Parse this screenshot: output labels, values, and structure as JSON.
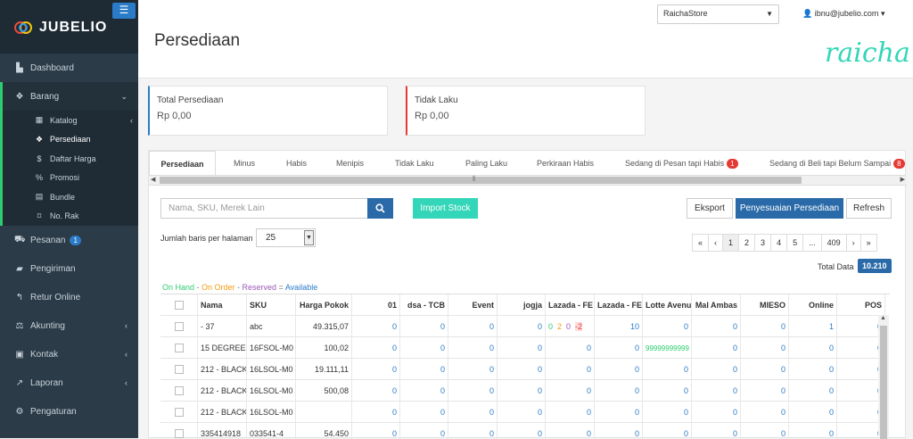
{
  "app": {
    "brand": "JUBELIO",
    "page_title": "Persediaan"
  },
  "sidebar": {
    "items": [
      {
        "label": "Dashboard",
        "icon": "chart-area-icon"
      },
      {
        "label": "Barang",
        "icon": "cubes-icon"
      },
      {
        "label": "Pesanan",
        "icon": "basket-icon",
        "badge": "1"
      },
      {
        "label": "Pengiriman",
        "icon": "truck-icon"
      },
      {
        "label": "Retur Online",
        "icon": "reply-icon"
      },
      {
        "label": "Akunting",
        "icon": "balance-icon"
      },
      {
        "label": "Kontak",
        "icon": "address-card-icon"
      },
      {
        "label": "Laporan",
        "icon": "line-chart-icon"
      },
      {
        "label": "Pengaturan",
        "icon": "cogs-icon"
      }
    ],
    "sub_items": [
      {
        "label": "Katalog",
        "icon": "grid-icon"
      },
      {
        "label": "Persediaan",
        "icon": "cubes-icon"
      },
      {
        "label": "Daftar Harga",
        "icon": "dollar-icon"
      },
      {
        "label": "Promosi",
        "icon": "percent-icon"
      },
      {
        "label": "Bundle",
        "icon": "th-icon"
      },
      {
        "label": "No. Rak",
        "icon": "bookmark-icon"
      }
    ]
  },
  "header": {
    "store": "RaichaStore",
    "user": "ibnu@jubelio.com",
    "signature": "raicha"
  },
  "cards": [
    {
      "title": "Total Persediaan",
      "value": "Rp 0,00",
      "accent": "#2a7bc8"
    },
    {
      "title": "Tidak Laku",
      "value": "Rp 0,00",
      "accent": "#e53935"
    }
  ],
  "tabs": [
    {
      "label": "Persediaan"
    },
    {
      "label": "Minus"
    },
    {
      "label": "Habis"
    },
    {
      "label": "Menipis"
    },
    {
      "label": "Tidak Laku"
    },
    {
      "label": "Paling Laku"
    },
    {
      "label": "Perkiraan Habis"
    },
    {
      "label": "Sedang di Pesan tapi Habis",
      "badge": "1"
    },
    {
      "label": "Sedang di Beli tapi Belum Sampai",
      "badge": "8"
    }
  ],
  "toolbar": {
    "search_placeholder": "Nama, SKU, Merek Lain",
    "import_label": "Import Stock",
    "export_label": "Eksport",
    "adjust_label": "Penyesuaian Persediaan",
    "refresh_label": "Refresh",
    "rows_label": "Jumlah baris per halaman",
    "rows_value": "25",
    "total_label": "Total Data",
    "total_value": "10.210"
  },
  "pager": [
    "«",
    "‹",
    "1",
    "2",
    "3",
    "4",
    "5",
    "...",
    "409",
    "›",
    "»"
  ],
  "legend": [
    {
      "text": "On Hand",
      "color": "#2ecc71"
    },
    {
      "text": " - ",
      "color": "#777"
    },
    {
      "text": "On Order",
      "color": "#f39c12"
    },
    {
      "text": " - ",
      "color": "#777"
    },
    {
      "text": "Reserved",
      "color": "#9b59b6"
    },
    {
      "text": " = ",
      "color": "#777"
    },
    {
      "text": "Available",
      "color": "#2a7bc8"
    }
  ],
  "table": {
    "columns": [
      "",
      "Nama",
      "SKU",
      "Harga Pokok",
      "01",
      "dsa - TCB",
      "Event",
      "jogja",
      "Lazada - FE",
      "Lazada - FE",
      "Lotte Avenue",
      "Mal Ambas",
      "MIESO",
      "Online",
      "POS"
    ],
    "rows": [
      [
        "",
        "- 37",
        "abc",
        "49.315,07",
        "0",
        "0",
        "0",
        "0",
        "",
        "10",
        "0",
        "0",
        "0",
        "1",
        "0"
      ],
      [
        "",
        "15 DEGREE",
        "16FSOL-M0",
        "100,02",
        "0",
        "0",
        "0",
        "0",
        "0",
        "0",
        "99999999999",
        "0",
        "0",
        "0",
        "0"
      ],
      [
        "",
        "212 - BLACK",
        "16LSOL-M0",
        "19.111,11",
        "0",
        "0",
        "0",
        "0",
        "0",
        "0",
        "0",
        "0",
        "0",
        "0",
        "0"
      ],
      [
        "",
        "212 - BLACK",
        "16LSOL-M0",
        "500,08",
        "0",
        "0",
        "0",
        "0",
        "0",
        "0",
        "0",
        "0",
        "0",
        "0",
        "0"
      ],
      [
        "",
        "212 - BLACK",
        "16LSOL-M0",
        "",
        "0",
        "0",
        "0",
        "0",
        "0",
        "0",
        "0",
        "0",
        "0",
        "0",
        "0"
      ],
      [
        "",
        "335414918",
        "033541-4",
        "54.450",
        "0",
        "0",
        "0",
        "0",
        "0",
        "0",
        "0",
        "0",
        "0",
        "0",
        "0"
      ]
    ],
    "lazada_breakdown": {
      "on_hand": "0",
      "on_order": "2",
      "reserved": "0",
      "available": "-2"
    }
  }
}
